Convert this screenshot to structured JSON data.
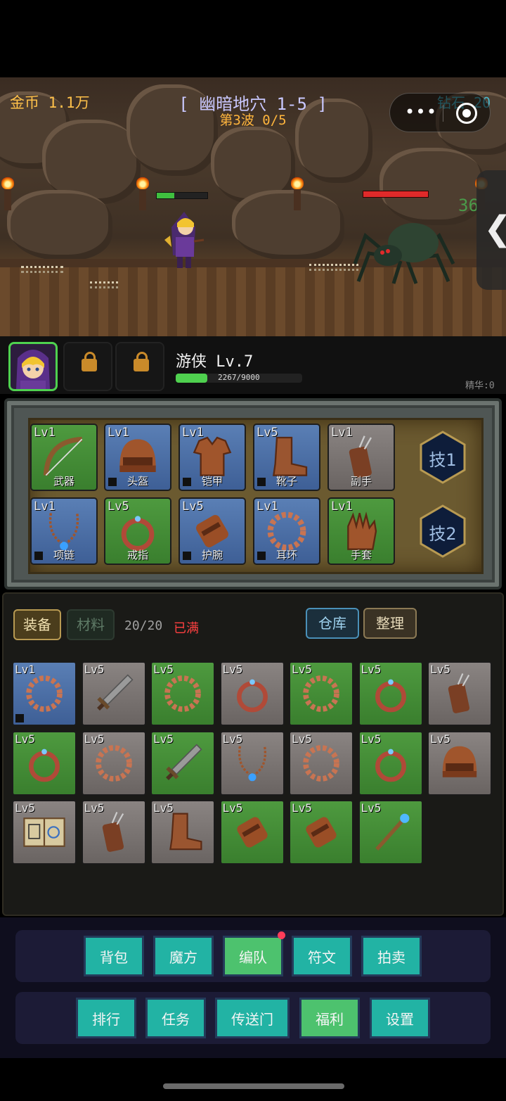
{
  "hud": {
    "gold_label": "金币 1.1万",
    "stage_title": "[ 幽暗地穴 1-5 ]",
    "wave": "第3波 0/5",
    "diamond_label": "钻石 20",
    "enemy_hp_value": "36"
  },
  "capsule": {
    "more_glyph": "•••",
    "more_icon": "more-dots-icon",
    "close_icon": "target-close-icon"
  },
  "side_handle": {
    "glyph": "❮"
  },
  "hero": {
    "name_level": "游侠 Lv.7",
    "xp_text": "2267/9000",
    "xp_fraction": 0.25,
    "essence": "精华:0",
    "hero_hp_fraction": 0.35,
    "enemy_hp_fraction": 1.0
  },
  "equipment": [
    {
      "lv": "Lv1",
      "name": "武器",
      "grade": "green",
      "icon": "bow-icon",
      "locked": false
    },
    {
      "lv": "Lv1",
      "name": "头盔",
      "grade": "blue",
      "icon": "helmet-icon",
      "locked": true
    },
    {
      "lv": "Lv1",
      "name": "铠甲",
      "grade": "blue",
      "icon": "armor-icon",
      "locked": true
    },
    {
      "lv": "Lv5",
      "name": "靴子",
      "grade": "blue",
      "icon": "boots-icon",
      "locked": true
    },
    {
      "lv": "Lv1",
      "name": "副手",
      "grade": "gray",
      "icon": "quiver-icon",
      "locked": false
    },
    {
      "lv": "Lv1",
      "name": "项链",
      "grade": "blue",
      "icon": "necklace-icon",
      "locked": true
    },
    {
      "lv": "Lv5",
      "name": "戒指",
      "grade": "green",
      "icon": "ring-icon",
      "locked": false
    },
    {
      "lv": "Lv5",
      "name": "护腕",
      "grade": "blue",
      "icon": "bracer-icon",
      "locked": true
    },
    {
      "lv": "Lv1",
      "name": "耳环",
      "grade": "blue",
      "icon": "earring-icon",
      "locked": true
    },
    {
      "lv": "Lv1",
      "name": "手套",
      "grade": "green",
      "icon": "glove-icon",
      "locked": false
    }
  ],
  "skills": [
    "技1",
    "技2"
  ],
  "inventory": {
    "tab_equip": "装备",
    "tab_material": "材料",
    "count": "20/20",
    "full_label": "已满",
    "storage_button": "仓库",
    "sort_button": "整理",
    "items": [
      {
        "lv": "Lv1",
        "grade": "blue",
        "icon": "earring-icon",
        "locked": true
      },
      {
        "lv": "Lv5",
        "grade": "gray",
        "icon": "sword-icon",
        "locked": false
      },
      {
        "lv": "Lv5",
        "grade": "green",
        "icon": "earring-icon",
        "locked": false
      },
      {
        "lv": "Lv5",
        "grade": "gray",
        "icon": "ring-icon",
        "locked": false
      },
      {
        "lv": "Lv5",
        "grade": "green",
        "icon": "earring-icon",
        "locked": false
      },
      {
        "lv": "Lv5",
        "grade": "green",
        "icon": "ring-icon",
        "locked": false
      },
      {
        "lv": "Lv5",
        "grade": "gray",
        "icon": "quiver-icon",
        "locked": false
      },
      {
        "lv": "Lv5",
        "grade": "green",
        "icon": "ring-icon",
        "locked": false
      },
      {
        "lv": "Lv5",
        "grade": "gray",
        "icon": "earring-icon",
        "locked": false
      },
      {
        "lv": "Lv5",
        "grade": "green",
        "icon": "sword-icon",
        "locked": false
      },
      {
        "lv": "Lv5",
        "grade": "gray",
        "icon": "necklace-icon",
        "locked": false
      },
      {
        "lv": "Lv5",
        "grade": "gray",
        "icon": "earring-icon",
        "locked": false
      },
      {
        "lv": "Lv5",
        "grade": "green",
        "icon": "ring-icon",
        "locked": false
      },
      {
        "lv": "Lv5",
        "grade": "gray",
        "icon": "helmet-icon",
        "locked": false
      },
      {
        "lv": "Lv5",
        "grade": "gray",
        "icon": "spellbook-icon",
        "locked": false
      },
      {
        "lv": "Lv5",
        "grade": "gray",
        "icon": "quiver-icon",
        "locked": false
      },
      {
        "lv": "Lv5",
        "grade": "gray",
        "icon": "boots-icon",
        "locked": false
      },
      {
        "lv": "Lv5",
        "grade": "green",
        "icon": "bracer-icon",
        "locked": false
      },
      {
        "lv": "Lv5",
        "grade": "green",
        "icon": "bracer-icon",
        "locked": false
      },
      {
        "lv": "Lv5",
        "grade": "green",
        "icon": "staff-icon",
        "locked": false
      }
    ]
  },
  "menu": {
    "row1": [
      {
        "label": "背包",
        "style": "teal",
        "dot": false
      },
      {
        "label": "魔方",
        "style": "teal",
        "dot": false
      },
      {
        "label": "编队",
        "style": "green",
        "dot": true
      },
      {
        "label": "符文",
        "style": "teal",
        "dot": false
      },
      {
        "label": "拍卖",
        "style": "teal",
        "dot": false
      }
    ],
    "row2": [
      {
        "label": "排行",
        "style": "teal",
        "dot": false
      },
      {
        "label": "任务",
        "style": "teal",
        "dot": false
      },
      {
        "label": "传送门",
        "style": "teal",
        "dot": false
      },
      {
        "label": "福利",
        "style": "green",
        "dot": false
      },
      {
        "label": "设置",
        "style": "teal",
        "dot": false
      }
    ]
  },
  "colors": {
    "gold": "#ffc14a",
    "diamond": "#4ab5c8",
    "full_red": "#ff4040",
    "menu_teal": "#22b3a4",
    "menu_green": "#4dc26e"
  }
}
